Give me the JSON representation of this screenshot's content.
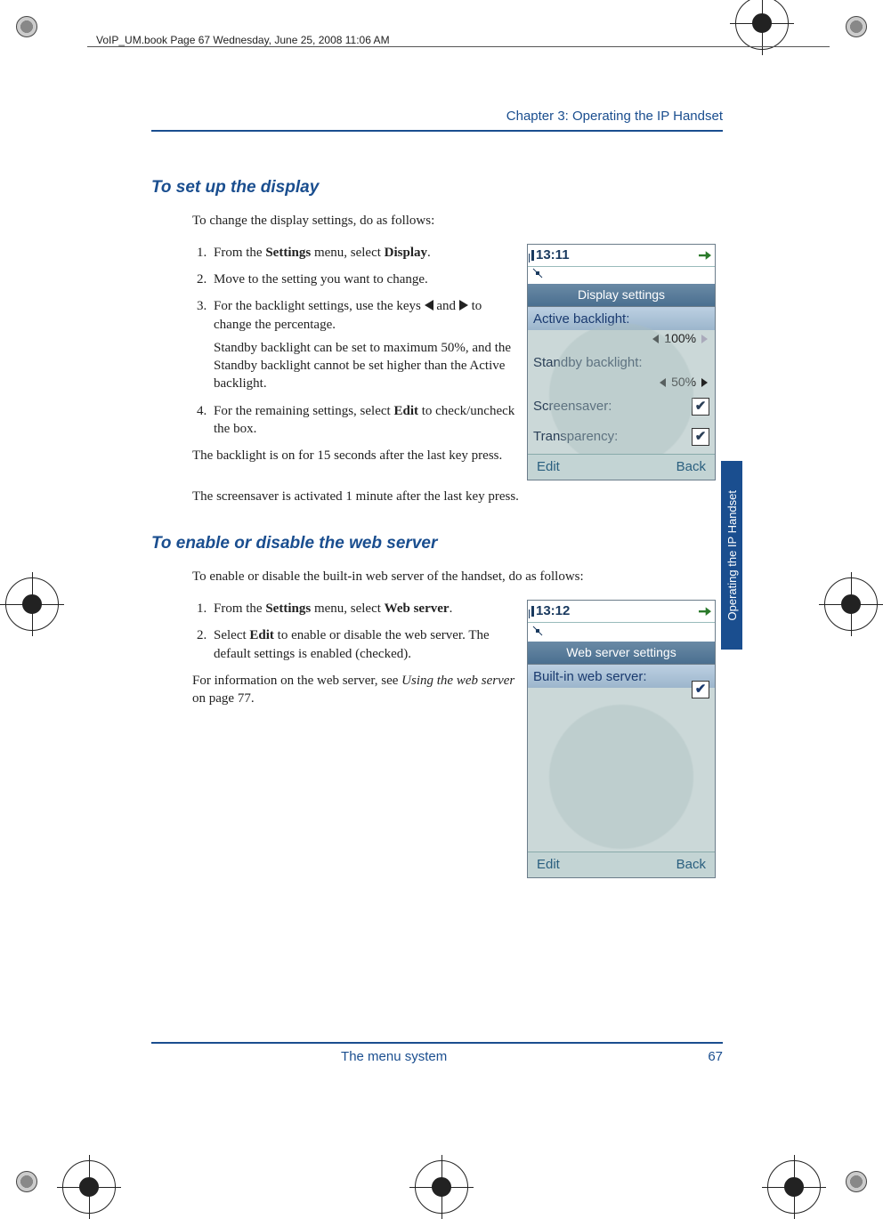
{
  "header_line": "VoIP_UM.book  Page 67  Wednesday, June 25, 2008  11:06 AM",
  "running_head": "Chapter 3:  Operating the IP Handset",
  "side_tab": "Operating the IP Handset",
  "section1": {
    "title": "To set up the display",
    "intro": "To change the display settings, do as follows:",
    "step1_pre": "From the ",
    "step1_b1": "Settings",
    "step1_mid": " menu, select ",
    "step1_b2": "Display",
    "step1_post": ".",
    "step2": "Move to the setting you want to change.",
    "step3_pre": "For the backlight settings, use the keys ",
    "step3_mid": " and  ",
    "step3_post": " to change the percentage.",
    "step3_note": "Standby backlight can be set to maximum 50%, and the Standby backlight cannot be set higher than the Active backlight.",
    "step4_pre": "For the remaining settings, select ",
    "step4_b": "Edit",
    "step4_post": " to check/uncheck the box.",
    "after1": "The backlight is on for 15 seconds after the last key press.",
    "after2": "The screensaver is activated 1 minute after the last key press."
  },
  "phone1": {
    "time": "13:11",
    "title": "Display settings",
    "row1": "Active backlight:",
    "val1": "100%",
    "row2": "Standby backlight:",
    "val2": "50%",
    "row3": "Screensaver:",
    "row4": "Transparency:",
    "check": "✔",
    "soft_left": "Edit",
    "soft_right": "Back"
  },
  "section2": {
    "title": "To enable or disable the web server",
    "intro": "To enable or disable the built-in web server of the handset, do as follows:",
    "step1_pre": "From the ",
    "step1_b1": "Settings",
    "step1_mid": " menu, select ",
    "step1_b2": "Web server",
    "step1_post": ".",
    "step2_pre": "Select ",
    "step2_b": "Edit",
    "step2_post": " to enable or disable the web server. The default settings is enabled (checked).",
    "after_pre": "For information on the web server, see ",
    "after_it": "Using the web server",
    "after_post": " on page 77."
  },
  "phone2": {
    "time": "13:12",
    "title": "Web server settings",
    "row1": "Built-in web server:",
    "check": "✔",
    "soft_left": "Edit",
    "soft_right": "Back"
  },
  "footer": {
    "title": "The menu system",
    "page": "67"
  }
}
